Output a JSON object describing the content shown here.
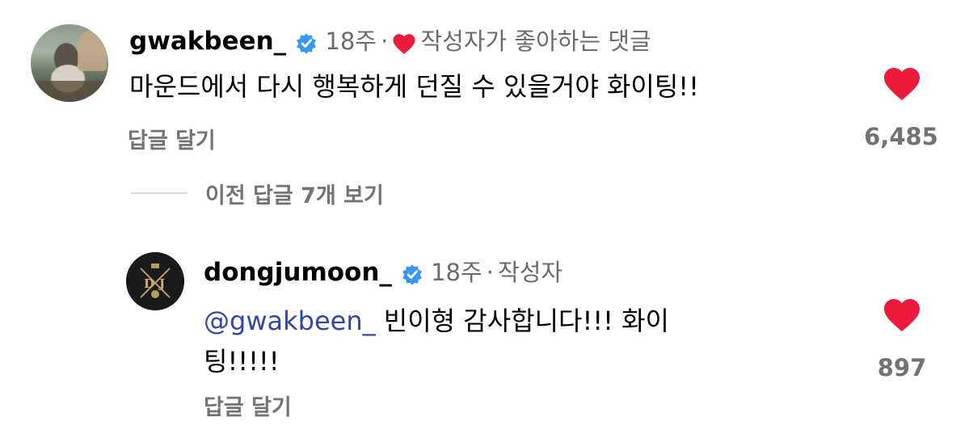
{
  "comment1": {
    "username": "gwakbeen_",
    "time": "18주",
    "separator": "·",
    "author_liked": "작성자가 좋아하는 댓글",
    "text": "마운드에서 다시 행복하게 던질 수 있을거야 화이팅!!",
    "reply_label": "답글 달기",
    "like_count": "6,485"
  },
  "view_replies": "이전 답글 7개 보기",
  "comment2": {
    "username": "dongjumoon_",
    "time": "18주",
    "separator": "·",
    "author_badge": "작성자",
    "mention": "@gwakbeen_",
    "text_line1": " 빈이형 감사합니다!!! 화이",
    "text_line2": "팅!!!!!",
    "reply_label": "답글 달기",
    "like_count": "897"
  },
  "colors": {
    "heart": "#ed1b3b",
    "verified": "#3897f0",
    "mention": "#3346a6",
    "secondary_text": "#737373"
  },
  "icons": [
    "verified-badge-icon",
    "heart-icon"
  ]
}
